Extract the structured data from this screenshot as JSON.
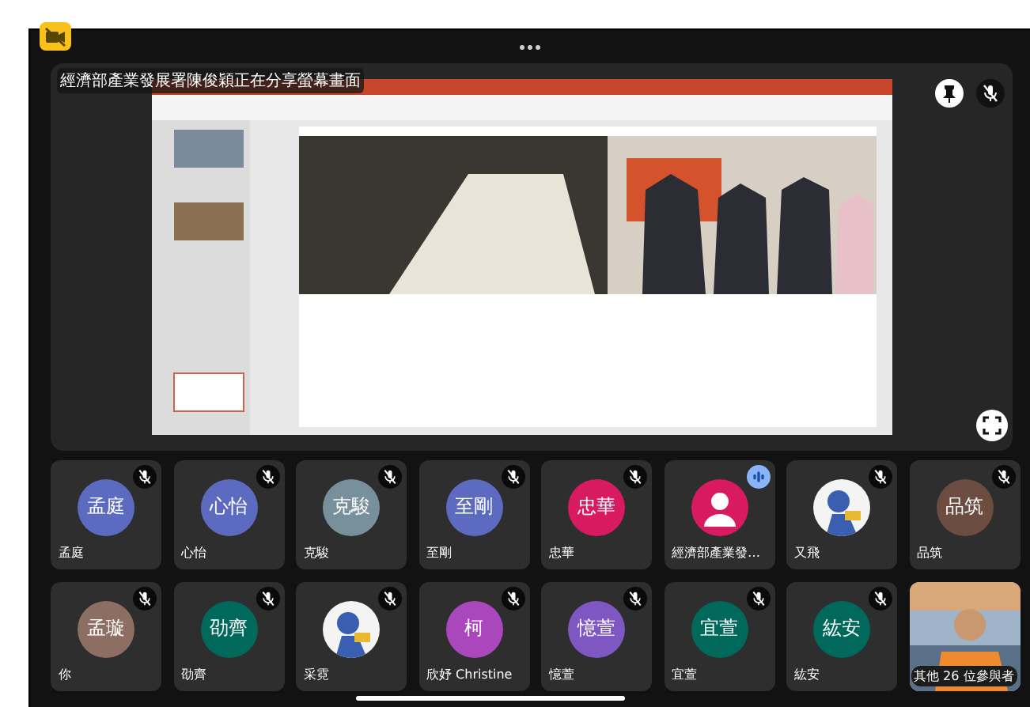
{
  "share": {
    "title": "經濟部產業發展署陳俊穎正在分享螢幕畫面"
  },
  "participants": [
    {
      "name": "孟庭",
      "avatar": {
        "kind": "initials",
        "text": "孟庭",
        "color": "#5c6bc0"
      },
      "muted": true
    },
    {
      "name": "心怡",
      "avatar": {
        "kind": "initials",
        "text": "心怡",
        "color": "#5c6bc0"
      },
      "muted": true
    },
    {
      "name": "克駿",
      "avatar": {
        "kind": "initials",
        "text": "克駿",
        "color": "#78909c"
      },
      "muted": true
    },
    {
      "name": "至剛",
      "avatar": {
        "kind": "initials",
        "text": "至剛",
        "color": "#5c6bc0"
      },
      "muted": true
    },
    {
      "name": "忠華",
      "avatar": {
        "kind": "initials",
        "text": "忠華",
        "color": "#d81b60"
      },
      "muted": true
    },
    {
      "name": "經濟部產業發…",
      "avatar": {
        "kind": "person",
        "color": "#d81b60"
      },
      "muted": false
    },
    {
      "name": "又飛",
      "muted": true
    },
    {
      "name": "品筑",
      "avatar": {
        "kind": "initials",
        "text": "品筑",
        "color": "#6d4c41"
      },
      "muted": true
    },
    {
      "name": "你",
      "avatar": {
        "kind": "initials",
        "text": "孟璇",
        "color": "#8d6e63"
      },
      "muted": true
    },
    {
      "name": "劭齊",
      "avatar": {
        "kind": "initials",
        "text": "劭齊",
        "color": "#00695c"
      },
      "muted": true
    },
    {
      "name": "采霓",
      "muted": true
    },
    {
      "name": "欣妤 Christine",
      "avatar": {
        "kind": "initials",
        "text": "柯",
        "color": "#ab47bc"
      },
      "muted": true
    },
    {
      "name": "憶萱",
      "avatar": {
        "kind": "initials",
        "text": "憶萱",
        "color": "#7e57c2"
      },
      "muted": true
    },
    {
      "name": "宜萱",
      "avatar": {
        "kind": "initials",
        "text": "宜萱",
        "color": "#00695c"
      },
      "muted": true
    },
    {
      "name": "紘安",
      "avatar": {
        "kind": "initials",
        "text": "紘安",
        "color": "#00695c"
      },
      "muted": true
    }
  ],
  "others": {
    "label": "其他 26 位參與者"
  }
}
